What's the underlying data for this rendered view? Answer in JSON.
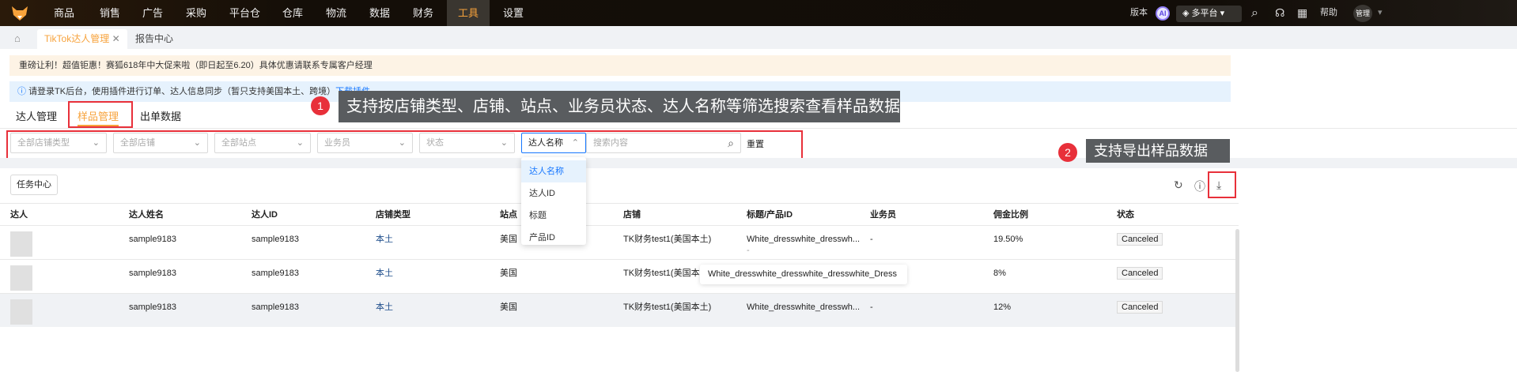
{
  "topnav": {
    "items": [
      "商品",
      "销售",
      "广告",
      "采购",
      "平台仓",
      "仓库",
      "物流",
      "数据",
      "财务",
      "工具",
      "设置"
    ],
    "active": "工具",
    "version": "版本",
    "ai": "AI",
    "platform": "多平台",
    "help": "帮助",
    "user": "管理"
  },
  "tabs": {
    "active": "TikTok达人管理",
    "other": "报告中心"
  },
  "banner": "重磅让利！超值钜惠！赛狐618年中大促来啦（即日起至6.20）具体优惠请联系专属客户经理",
  "info": {
    "text": "请登录TK后台，使用插件进行订单、达人信息同步（暂只支持美国本土、跨境）",
    "link": "下载插件"
  },
  "subtabs": [
    "达人管理",
    "样品管理",
    "出单数据"
  ],
  "callouts": [
    {
      "num": "1",
      "text": "支持按店铺类型、店铺、站点、业务员状态、达人名称等筛选搜索查看样品数据"
    },
    {
      "num": "2",
      "text": "支持导出样品数据"
    }
  ],
  "filters": {
    "shop_type": "全部店铺类型",
    "shop": "全部店铺",
    "site": "全部站点",
    "salesman": "业务员",
    "status": "状态",
    "search_field": "达人名称",
    "search_placeholder": "搜索内容",
    "reset": "重置"
  },
  "dropdown": [
    "达人名称",
    "达人ID",
    "标题",
    "产品ID"
  ],
  "task_center": "任务中心",
  "table": {
    "headers": [
      "达人",
      "达人姓名",
      "达人ID",
      "店铺类型",
      "站点",
      "店铺",
      "标题/产品ID",
      "业务员",
      "佣金比例",
      "状态"
    ],
    "rows": [
      {
        "name": "sample9183",
        "id": "sample9183",
        "type": "本土",
        "site": "美国",
        "shop": "TK财务test1(美国本土)",
        "title": "White_dresswhite_dresswh...",
        "pid": "-",
        "salesman": "-",
        "rate": "19.50%",
        "status": "Canceled"
      },
      {
        "name": "sample9183",
        "id": "sample9183",
        "type": "本土",
        "site": "美国",
        "shop": "TK财务test1(美国本土)",
        "title": "",
        "pid": "",
        "salesman": "",
        "rate": "8%",
        "status": "Canceled"
      },
      {
        "name": "sample9183",
        "id": "sample9183",
        "type": "本土",
        "site": "美国",
        "shop": "TK财务test1(美国本土)",
        "title": "White_dresswhite_dresswh...",
        "pid": "",
        "salesman": "-",
        "rate": "12%",
        "status": "Canceled"
      }
    ]
  },
  "tooltip": "White_dresswhite_dresswhite_dresswhite_Dress"
}
